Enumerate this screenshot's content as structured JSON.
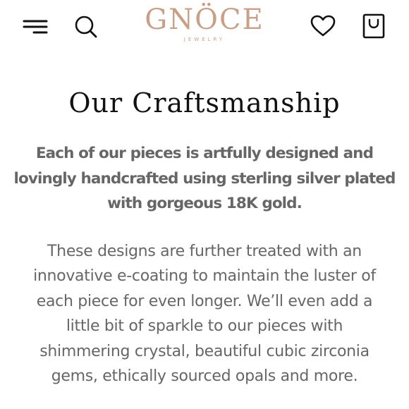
{
  "header": {
    "icons": [
      "menu-icon",
      "search-icon",
      "heart-icon",
      "shopping-bag-icon"
    ],
    "logo": {
      "name": "GNÖCE",
      "tagline": "JEWELRY",
      "color": "#c9a087"
    }
  },
  "main": {
    "title": "Our Craftsmanship",
    "lead_lines": [
      "Each of our pieces is artfully designed and",
      "lovingly handcrafted using sterling silver plated",
      "with gorgeous 18K gold."
    ],
    "body_lines": [
      "These designs are further treated with an",
      "innovative e-coating to maintain the luster of",
      "each piece for even longer. We’ll even add a",
      "little bit of sparkle to our pieces with",
      "shimmering crystal, beautiful cubic zirconia",
      "gems, ethically sourced opals and more."
    ]
  },
  "colors": {
    "text": "#666666",
    "title": "#111111",
    "brand": "#c9a087"
  }
}
